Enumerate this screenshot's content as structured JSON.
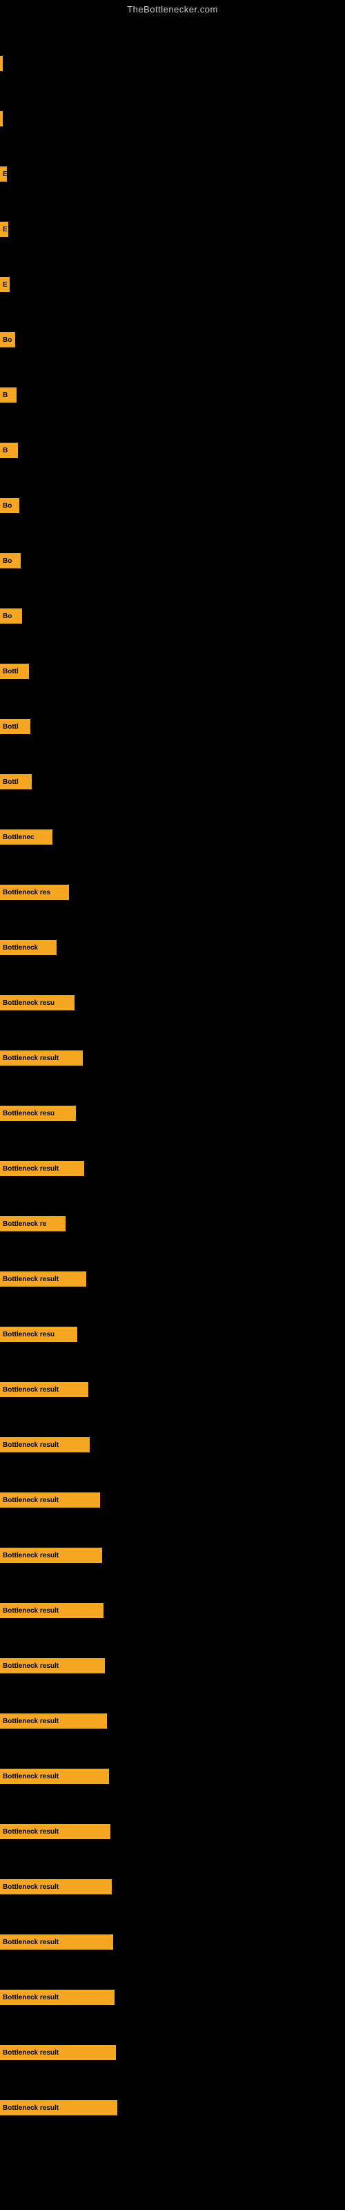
{
  "site_title": "TheBottlenecker.com",
  "bars": [
    {
      "label": "",
      "width": 3
    },
    {
      "label": "",
      "width": 3
    },
    {
      "label": "E",
      "width": 10
    },
    {
      "label": "E",
      "width": 12
    },
    {
      "label": "E",
      "width": 14
    },
    {
      "label": "Bo",
      "width": 22
    },
    {
      "label": "B",
      "width": 24
    },
    {
      "label": "B",
      "width": 26
    },
    {
      "label": "Bo",
      "width": 28
    },
    {
      "label": "Bo",
      "width": 30
    },
    {
      "label": "Bo",
      "width": 32
    },
    {
      "label": "Bottl",
      "width": 42
    },
    {
      "label": "Bottl",
      "width": 44
    },
    {
      "label": "Bottl",
      "width": 46
    },
    {
      "label": "Bottlenec",
      "width": 76
    },
    {
      "label": "Bottleneck res",
      "width": 100
    },
    {
      "label": "Bottleneck",
      "width": 82
    },
    {
      "label": "Bottleneck resu",
      "width": 108
    },
    {
      "label": "Bottleneck result",
      "width": 120
    },
    {
      "label": "Bottleneck resu",
      "width": 110
    },
    {
      "label": "Bottleneck result",
      "width": 122
    },
    {
      "label": "Bottleneck re",
      "width": 95
    },
    {
      "label": "Bottleneck result",
      "width": 125
    },
    {
      "label": "Bottleneck resu",
      "width": 112
    },
    {
      "label": "Bottleneck result",
      "width": 128
    },
    {
      "label": "Bottleneck result",
      "width": 130
    },
    {
      "label": "Bottleneck result",
      "width": 145
    },
    {
      "label": "Bottleneck result",
      "width": 148
    },
    {
      "label": "Bottleneck result",
      "width": 150
    },
    {
      "label": "Bottleneck result",
      "width": 152
    },
    {
      "label": "Bottleneck result",
      "width": 155
    },
    {
      "label": "Bottleneck result",
      "width": 158
    },
    {
      "label": "Bottleneck result",
      "width": 160
    },
    {
      "label": "Bottleneck result",
      "width": 162
    },
    {
      "label": "Bottleneck result",
      "width": 164
    },
    {
      "label": "Bottleneck result",
      "width": 166
    },
    {
      "label": "Bottleneck result",
      "width": 168
    },
    {
      "label": "Bottleneck result",
      "width": 170
    }
  ]
}
